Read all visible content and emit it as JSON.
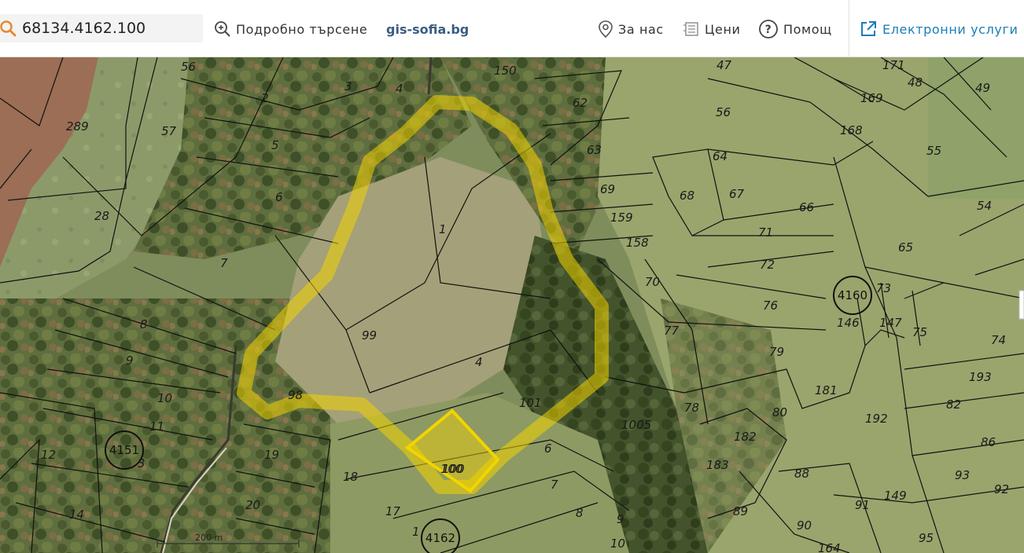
{
  "search": {
    "value": "68134.4162.100"
  },
  "toolbar": {
    "advanced_search": "Подробно търсене",
    "brand": "gis-sofia.bg",
    "about": "За нас",
    "prices": "Цени",
    "help": "Помощ",
    "eservices": "Електронни услуги"
  },
  "colors": {
    "highlight": "#f2d400",
    "brand": "#3a5d82",
    "link": "#1a7fb5"
  },
  "map": {
    "blocks": [
      "4151",
      "4160",
      "4162"
    ],
    "selected_parcel": "100",
    "scale": "200 m",
    "parcels": [
      "56",
      "289",
      "57",
      "2",
      "3",
      "4",
      "150",
      "62",
      "5",
      "63",
      "47",
      "171",
      "48",
      "49",
      "56",
      "169",
      "168",
      "55",
      "28",
      "6",
      "1",
      "69",
      "159",
      "158",
      "64",
      "68",
      "67",
      "66",
      "54",
      "71",
      "65",
      "7",
      "72",
      "70",
      "76",
      "4160",
      "73",
      "146",
      "147",
      "75",
      "8",
      "99",
      "77",
      "79",
      "74",
      "181",
      "193",
      "9",
      "4",
      "78",
      "80",
      "82",
      "10",
      "98",
      "101",
      "192",
      "11",
      "1005",
      "182",
      "86",
      "12",
      "4151",
      "3",
      "19",
      "6",
      "183",
      "88",
      "93",
      "18",
      "100",
      "7",
      "92",
      "20",
      "17",
      "8",
      "149",
      "89",
      "90",
      "14",
      "9",
      "91",
      "10",
      "95",
      "164",
      "1"
    ]
  }
}
